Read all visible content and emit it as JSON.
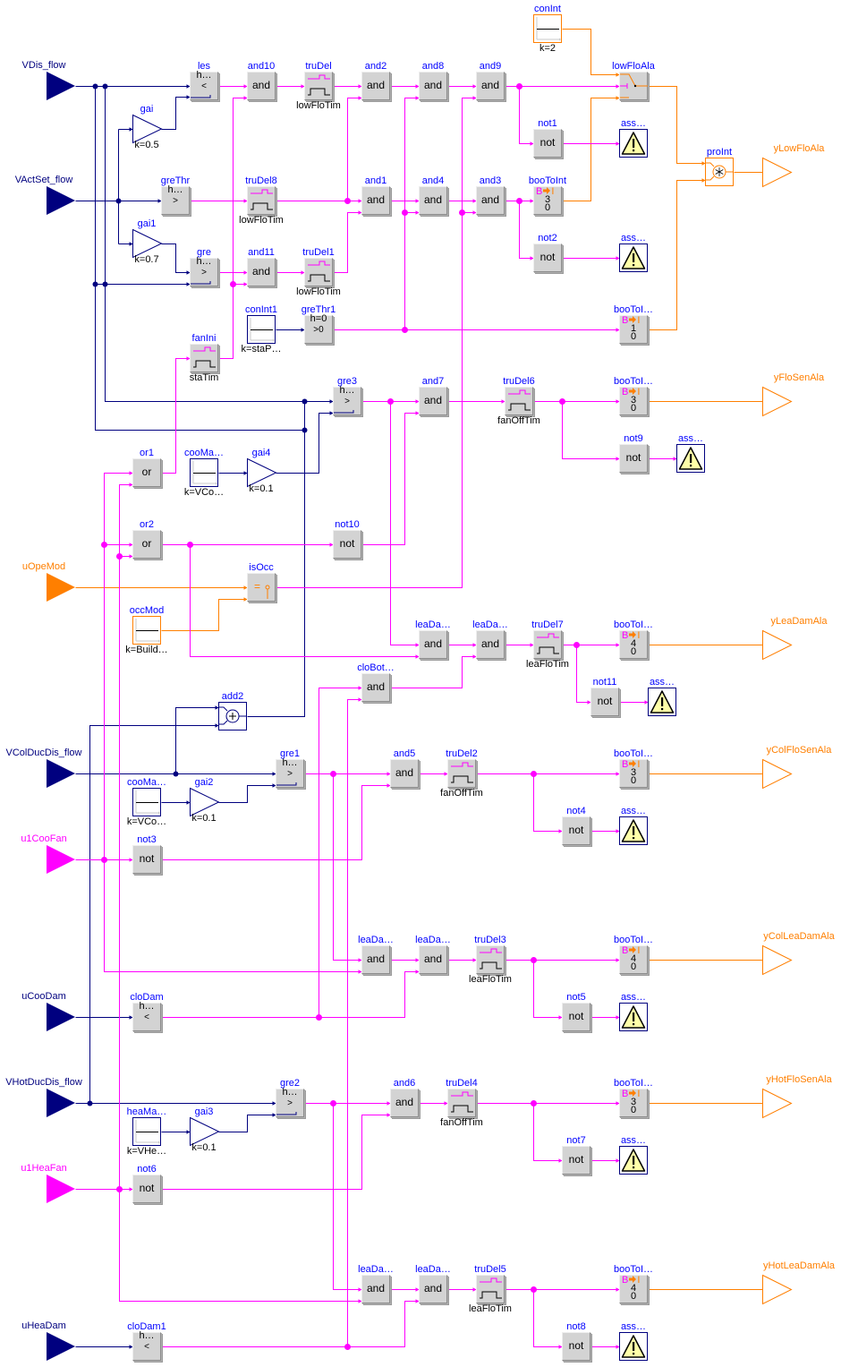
{
  "colors": {
    "real_signal": "#00007f",
    "boolean_signal": "#ff00ff",
    "integer_signal": "#ff7f00",
    "block_name": "#0000ff"
  },
  "diagram": {
    "inputs": [
      {
        "label": "VDis_flow",
        "signal": "real"
      },
      {
        "label": "VActSet_flow",
        "signal": "real"
      },
      {
        "label": "uOpeMod",
        "signal": "integer"
      },
      {
        "label": "VColDucDis_flow",
        "signal": "real"
      },
      {
        "label": "u1CooFan",
        "signal": "boolean"
      },
      {
        "label": "uCooDam",
        "signal": "real"
      },
      {
        "label": "VHotDucDis_flow",
        "signal": "real"
      },
      {
        "label": "u1HeaFan",
        "signal": "boolean"
      },
      {
        "label": "uHeaDam",
        "signal": "real"
      }
    ],
    "outputs": [
      {
        "label": "yLowFloAla",
        "signal": "integer"
      },
      {
        "label": "yFloSenAla",
        "signal": "integer"
      },
      {
        "label": "yLeaDamAla",
        "signal": "integer"
      },
      {
        "label": "yColFloSenAla",
        "signal": "integer"
      },
      {
        "label": "yColLeaDamAla",
        "signal": "integer"
      },
      {
        "label": "yHotFloSenAla",
        "signal": "integer"
      },
      {
        "label": "yHotLeaDamAla",
        "signal": "integer"
      }
    ],
    "blocks": {
      "les": {
        "name": "les",
        "kind": "less",
        "param": "h…",
        "symbol": "<"
      },
      "and10": {
        "name": "and10",
        "kind": "and",
        "symbol": "and"
      },
      "truDel": {
        "name": "truDel",
        "kind": "true-delay",
        "param": "lowFloTim"
      },
      "and2": {
        "name": "and2",
        "kind": "and",
        "symbol": "and"
      },
      "and8": {
        "name": "and8",
        "kind": "and",
        "symbol": "and"
      },
      "and9": {
        "name": "and9",
        "kind": "and",
        "symbol": "and"
      },
      "conInt": {
        "name": "conInt",
        "kind": "constant",
        "signal": "integer",
        "param": "k=2"
      },
      "lowFloAla": {
        "name": "lowFloAla",
        "kind": "integer-switch"
      },
      "gai": {
        "name": "gai",
        "kind": "gain",
        "param": "k=0.5"
      },
      "not1": {
        "name": "not1",
        "kind": "not",
        "symbol": "not"
      },
      "ass1": {
        "name": "ass…",
        "kind": "assert"
      },
      "proInt": {
        "name": "proInt",
        "kind": "multiply",
        "signal": "integer"
      },
      "greThr": {
        "name": "greThr",
        "kind": "greater-threshold",
        "param": "h…",
        "symbol": ">"
      },
      "truDel8": {
        "name": "truDel8",
        "kind": "true-delay",
        "param": "lowFloTim"
      },
      "and1": {
        "name": "and1",
        "kind": "and",
        "symbol": "and"
      },
      "and4": {
        "name": "and4",
        "kind": "and",
        "symbol": "and"
      },
      "and3": {
        "name": "and3",
        "kind": "and",
        "symbol": "and"
      },
      "booToInt": {
        "name": "booToInt",
        "kind": "boolean-to-integer",
        "from": "B",
        "to": "I",
        "integer_true": "3",
        "integer_false": "0"
      },
      "gai1": {
        "name": "gai1",
        "kind": "gain",
        "param": "k=0.7"
      },
      "not2": {
        "name": "not2",
        "kind": "not",
        "symbol": "not"
      },
      "ass2": {
        "name": "ass…",
        "kind": "assert"
      },
      "gre": {
        "name": "gre",
        "kind": "greater",
        "param": "h…",
        "symbol": ">"
      },
      "and11": {
        "name": "and11",
        "kind": "and",
        "symbol": "and"
      },
      "truDel1": {
        "name": "truDel1",
        "kind": "true-delay",
        "param": "lowFloTim"
      },
      "conInt1": {
        "name": "conInt1",
        "kind": "constant",
        "signal": "real",
        "param": "k=staP…"
      },
      "greThr1": {
        "name": "greThr1",
        "kind": "greater-threshold",
        "param": "h=0",
        "symbol": ">0"
      },
      "booToI1": {
        "name": "booToI…",
        "kind": "boolean-to-integer",
        "from": "B",
        "to": "I",
        "integer_true": "1",
        "integer_false": "0"
      },
      "fanIni": {
        "name": "fanIni",
        "kind": "true-delay",
        "param": "staTim"
      },
      "gre3": {
        "name": "gre3",
        "kind": "greater",
        "param": "h…",
        "symbol": ">"
      },
      "and7": {
        "name": "and7",
        "kind": "and",
        "symbol": "and"
      },
      "truDel6": {
        "name": "truDel6",
        "kind": "true-delay",
        "param": "fanOffTim"
      },
      "booToI2": {
        "name": "booToI…",
        "kind": "boolean-to-integer",
        "from": "B",
        "to": "I",
        "integer_true": "3",
        "integer_false": "0"
      },
      "not9": {
        "name": "not9",
        "kind": "not",
        "symbol": "not"
      },
      "ass3": {
        "name": "ass…",
        "kind": "assert"
      },
      "or1": {
        "name": "or1",
        "kind": "or",
        "symbol": "or"
      },
      "cooMa1": {
        "name": "cooMa…",
        "kind": "constant",
        "signal": "real",
        "param": "k=VCo…"
      },
      "gai4": {
        "name": "gai4",
        "kind": "gain",
        "param": "k=0.1"
      },
      "or2": {
        "name": "or2",
        "kind": "or",
        "symbol": "or"
      },
      "not10": {
        "name": "not10",
        "kind": "not",
        "symbol": "not"
      },
      "isOcc": {
        "name": "isOcc",
        "kind": "equal",
        "symbol": "="
      },
      "occMod": {
        "name": "occMod",
        "kind": "constant",
        "signal": "integer",
        "param": "k=Build…"
      },
      "leaDa1": {
        "name": "leaDa…",
        "kind": "and",
        "symbol": "and"
      },
      "leaDa2": {
        "name": "leaDa…",
        "kind": "and",
        "symbol": "and"
      },
      "truDel7": {
        "name": "truDel7",
        "kind": "true-delay",
        "param": "leaFloTim"
      },
      "booToI3": {
        "name": "booToI…",
        "kind": "boolean-to-integer",
        "from": "B",
        "to": "I",
        "integer_true": "4",
        "integer_false": "0"
      },
      "cloBot": {
        "name": "cloBot…",
        "kind": "and",
        "symbol": "and"
      },
      "not11": {
        "name": "not11",
        "kind": "not",
        "symbol": "not"
      },
      "ass4": {
        "name": "ass…",
        "kind": "assert"
      },
      "add2": {
        "name": "add2",
        "kind": "add",
        "signal": "real"
      },
      "gre1": {
        "name": "gre1",
        "kind": "greater",
        "param": "h…",
        "symbol": ">"
      },
      "and5": {
        "name": "and5",
        "kind": "and",
        "symbol": "and"
      },
      "truDel2": {
        "name": "truDel2",
        "kind": "true-delay",
        "param": "fanOffTim"
      },
      "booToI4": {
        "name": "booToI…",
        "kind": "boolean-to-integer",
        "from": "B",
        "to": "I",
        "integer_true": "3",
        "integer_false": "0"
      },
      "cooMa2": {
        "name": "cooMa…",
        "kind": "constant",
        "signal": "real",
        "param": "k=VCo…"
      },
      "gai2": {
        "name": "gai2",
        "kind": "gain",
        "param": "k=0.1"
      },
      "not3": {
        "name": "not3",
        "kind": "not",
        "symbol": "not"
      },
      "not4": {
        "name": "not4",
        "kind": "not",
        "symbol": "not"
      },
      "ass5": {
        "name": "ass…",
        "kind": "assert"
      },
      "leaDa3": {
        "name": "leaDa…",
        "kind": "and",
        "symbol": "and"
      },
      "leaDa4": {
        "name": "leaDa…",
        "kind": "and",
        "symbol": "and"
      },
      "truDel3": {
        "name": "truDel3",
        "kind": "true-delay",
        "param": "leaFloTim"
      },
      "booToI5": {
        "name": "booToI…",
        "kind": "boolean-to-integer",
        "from": "B",
        "to": "I",
        "integer_true": "4",
        "integer_false": "0"
      },
      "not5": {
        "name": "not5",
        "kind": "not",
        "symbol": "not"
      },
      "ass6": {
        "name": "ass…",
        "kind": "assert"
      },
      "cloDam": {
        "name": "cloDam",
        "kind": "less-threshold",
        "param": "h…",
        "symbol": "<"
      },
      "gre2": {
        "name": "gre2",
        "kind": "greater",
        "param": "h…",
        "symbol": ">"
      },
      "and6": {
        "name": "and6",
        "kind": "and",
        "symbol": "and"
      },
      "truDel4": {
        "name": "truDel4",
        "kind": "true-delay",
        "param": "fanOffTim"
      },
      "booToI6": {
        "name": "booToI…",
        "kind": "boolean-to-integer",
        "from": "B",
        "to": "I",
        "integer_true": "3",
        "integer_false": "0"
      },
      "heaMa": {
        "name": "heaMa…",
        "kind": "constant",
        "signal": "real",
        "param": "k=VHe…"
      },
      "gai3": {
        "name": "gai3",
        "kind": "gain",
        "param": "k=0.1"
      },
      "not7": {
        "name": "not7",
        "kind": "not",
        "symbol": "not"
      },
      "ass7": {
        "name": "ass…",
        "kind": "assert"
      },
      "not6": {
        "name": "not6",
        "kind": "not",
        "symbol": "not"
      },
      "leaDa5": {
        "name": "leaDa…",
        "kind": "and",
        "symbol": "and"
      },
      "leaDa6": {
        "name": "leaDa…",
        "kind": "and",
        "symbol": "and"
      },
      "truDel5": {
        "name": "truDel5",
        "kind": "true-delay",
        "param": "leaFloTim"
      },
      "booToI7": {
        "name": "booToI…",
        "kind": "boolean-to-integer",
        "from": "B",
        "to": "I",
        "integer_true": "4",
        "integer_false": "0"
      },
      "not8": {
        "name": "not8",
        "kind": "not",
        "symbol": "not"
      },
      "ass8": {
        "name": "ass…",
        "kind": "assert"
      },
      "cloDam1": {
        "name": "cloDam1",
        "kind": "less-threshold",
        "param": "h…",
        "symbol": "<"
      }
    }
  }
}
